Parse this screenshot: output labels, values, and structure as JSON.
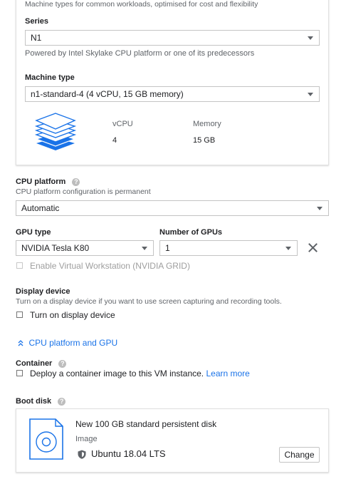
{
  "machine_config": {
    "family_hint": "Machine types for common workloads, optimised for cost and flexibility",
    "series_label": "Series",
    "series_value": "N1",
    "series_hint": "Powered by Intel Skylake CPU platform or one of its predecessors",
    "machine_type_label": "Machine type",
    "machine_type_value": "n1-standard-4 (4 vCPU, 15 GB memory)",
    "vcpu_label": "vCPU",
    "vcpu_value": "4",
    "memory_label": "Memory",
    "memory_value": "15 GB",
    "icon": "stacked-layers-icon"
  },
  "cpu_platform": {
    "label": "CPU platform",
    "hint": "CPU platform configuration is permanent",
    "value": "Automatic"
  },
  "gpu": {
    "type_label": "GPU type",
    "type_value": "NVIDIA Tesla K80",
    "count_label": "Number of GPUs",
    "count_value": "1",
    "virtual_workstation_label": "Enable Virtual Workstation (NVIDIA GRID)"
  },
  "display_device": {
    "label": "Display device",
    "hint": "Turn on a display device if you want to use screen capturing and recording tools.",
    "checkbox_label": "Turn on display device"
  },
  "collapse_link": "CPU platform and GPU",
  "container": {
    "label": "Container",
    "checkbox_label": "Deploy a container image to this VM instance.",
    "learn_more": "Learn more"
  },
  "boot_disk": {
    "label": "Boot disk",
    "title": "New 100 GB standard persistent disk",
    "image_label": "Image",
    "image_value": "Ubuntu 18.04 LTS",
    "change_button": "Change"
  },
  "colors": {
    "accent": "#1a73e8",
    "icon_blue": "#1a73e8"
  }
}
